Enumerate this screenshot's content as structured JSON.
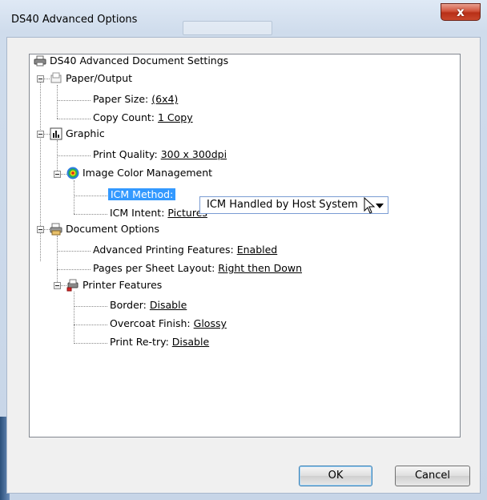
{
  "window": {
    "title": "DS40 Advanced Options",
    "close_glyph": "x"
  },
  "tree": {
    "root": "DS40 Advanced Document Settings",
    "paper_output": {
      "label": "Paper/Output",
      "paper_size_label": "Paper Size:",
      "paper_size_value": "(6x4)",
      "copy_count_label": "Copy Count:",
      "copy_count_value": "1 Copy"
    },
    "graphic": {
      "label": "Graphic",
      "print_quality_label": "Print Quality:",
      "print_quality_value": "300 x 300dpi",
      "icm": {
        "label": "Image Color Management",
        "method_label": "ICM Method:",
        "method_value": "ICM Handled by Host System",
        "intent_label": "ICM Intent:",
        "intent_value": "Pictures"
      }
    },
    "document_options": {
      "label": "Document Options",
      "advanced_label": "Advanced Printing Features:",
      "advanced_value": "Enabled",
      "pages_label": "Pages per Sheet Layout:",
      "pages_value": "Right then Down",
      "printer_features": {
        "label": "Printer Features",
        "border_label": "Border:",
        "border_value": "Disable",
        "overcoat_label": "Overcoat Finish:",
        "overcoat_value": "Glossy",
        "retry_label": "Print Re-try:",
        "retry_value": "Disable"
      }
    }
  },
  "buttons": {
    "ok": "OK",
    "cancel": "Cancel"
  },
  "icons": [
    "printer-icon",
    "paper-output-icon",
    "graphic-icon",
    "color-management-icon",
    "document-options-icon",
    "printer-features-icon"
  ],
  "colors": {
    "selection": "#3399ff",
    "close_button": "#c9472c"
  }
}
